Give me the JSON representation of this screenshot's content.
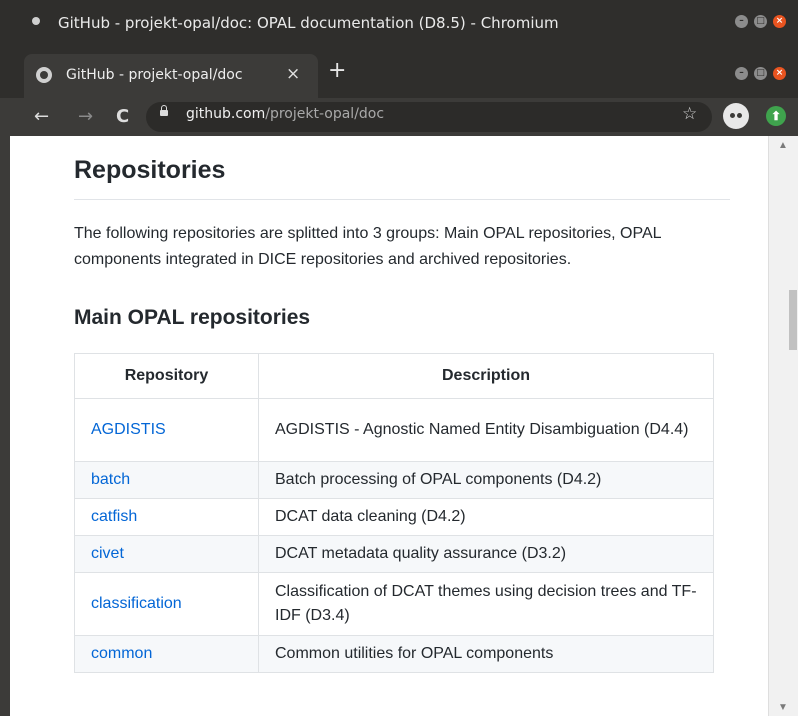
{
  "window": {
    "title": "GitHub - projekt-opal/doc: OPAL documentation (D8.5) - Chromium"
  },
  "tab": {
    "title": "GitHub - projekt-opal/doc",
    "close": "×",
    "new_tab": "+"
  },
  "toolbar": {
    "back": "←",
    "forward": "→",
    "reload": "C",
    "url_host": "github.com",
    "url_path": "/projekt-opal/doc",
    "star": "☆"
  },
  "content": {
    "heading": "Repositories",
    "intro": "The following repositories are splitted into 3 groups: Main OPAL repositories, OPAL components integrated in DICE repositories and archived repositories.",
    "subheading": "Main OPAL repositories",
    "table": {
      "headers": [
        "Repository",
        "Description"
      ],
      "rows": [
        {
          "repo": "AGDISTIS",
          "desc": "AGDISTIS - Agnostic Named Entity Disambiguation (D4.4)"
        },
        {
          "repo": "batch",
          "desc": "Batch processing of OPAL components (D4.2)"
        },
        {
          "repo": "catfish",
          "desc": "DCAT data cleaning (D4.2)"
        },
        {
          "repo": "civet",
          "desc": "DCAT metadata quality assurance (D3.2)"
        },
        {
          "repo": "classification",
          "desc": "Classification of DCAT themes using decision trees and TF-IDF (D3.4)"
        },
        {
          "repo": "common",
          "desc": "Common utilities for OPAL components"
        }
      ]
    }
  },
  "colors": {
    "link": "#0366d6",
    "text": "#24292e",
    "titlebar": "#2f2e2c",
    "close_button": "#e95420"
  }
}
